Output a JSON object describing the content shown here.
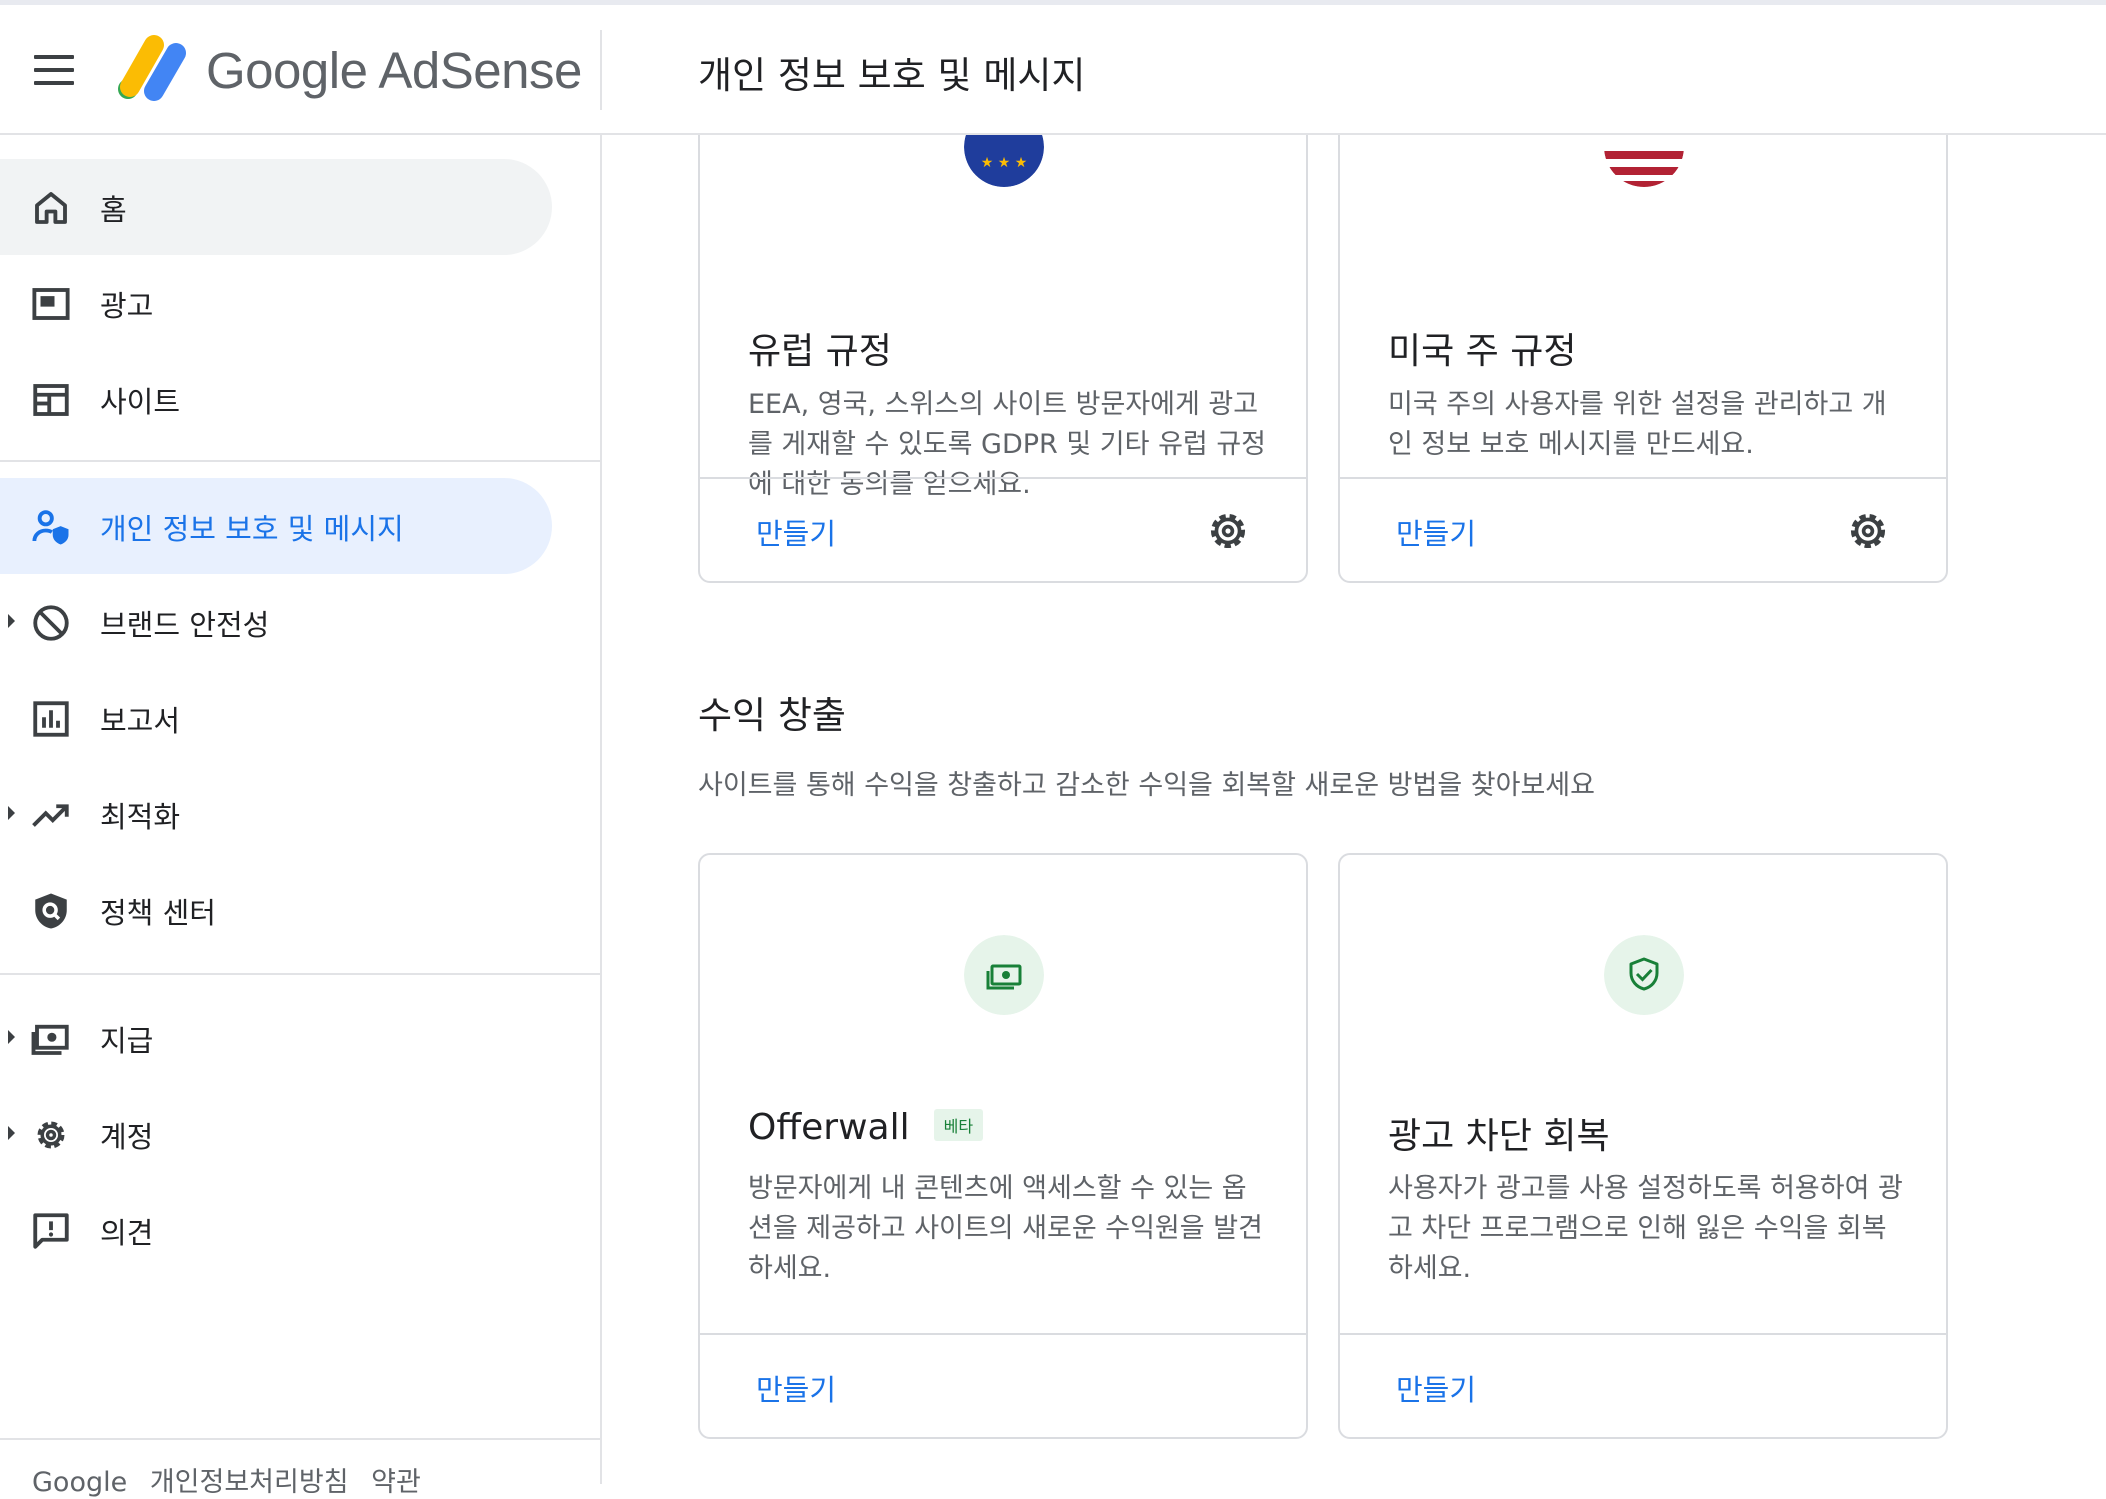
{
  "header": {
    "brand_google": "Google",
    "brand_product": "AdSense",
    "page_title": "개인 정보 보호 및 메시지"
  },
  "sidebar": {
    "items": [
      {
        "label": "홈",
        "icon": "home-icon"
      },
      {
        "label": "광고",
        "icon": "ads-icon"
      },
      {
        "label": "사이트",
        "icon": "sites-icon"
      },
      {
        "label": "개인 정보 보호 및 메시지",
        "icon": "privacy-messaging-icon"
      },
      {
        "label": "브랜드 안전성",
        "icon": "block-icon"
      },
      {
        "label": "보고서",
        "icon": "reports-icon"
      },
      {
        "label": "최적화",
        "icon": "trending-up-icon"
      },
      {
        "label": "정책 센터",
        "icon": "shield-search-icon"
      },
      {
        "label": "지급",
        "icon": "payments-icon"
      },
      {
        "label": "계정",
        "icon": "gear-icon"
      },
      {
        "label": "의견",
        "icon": "feedback-icon"
      }
    ],
    "footer": {
      "google": "Google",
      "privacy": "개인정보처리방침",
      "terms": "약관"
    }
  },
  "cards_top": [
    {
      "title": "유럽 규정",
      "description": "EEA, 영국, 스위스의 사이트 방문자에게 광고를 게재할 수 있도록 GDPR 및 기타 유럽 규정에 대한 동의를 얻으세요.",
      "action": "만들기"
    },
    {
      "title": "미국 주 규정",
      "description": "미국 주의 사용자를 위한 설정을 관리하고 개인 정보 보호 메시지를 만드세요.",
      "action": "만들기"
    }
  ],
  "monetization": {
    "title": "수익 창출",
    "description": "사이트를 통해 수익을 창출하고 감소한 수익을 회복할 새로운 방법을 찾아보세요",
    "cards": [
      {
        "title": "Offerwall",
        "badge": "베타",
        "description": "방문자에게 내 콘텐츠에 액세스할 수 있는 옵션을 제공하고 사이트의 새로운 수익원을 발견하세요.",
        "action": "만들기"
      },
      {
        "title": "광고 차단 회복",
        "description": "사용자가 광고를 사용 설정하도록 허용하여 광고 차단 프로그램으로 인해 잃은 수익을 회복하세요.",
        "action": "만들기"
      }
    ]
  },
  "colors": {
    "accent": "#1a73e8",
    "active_bg": "#e8f0fe",
    "badge_bg": "#e6f4ea",
    "badge_text": "#188038"
  }
}
